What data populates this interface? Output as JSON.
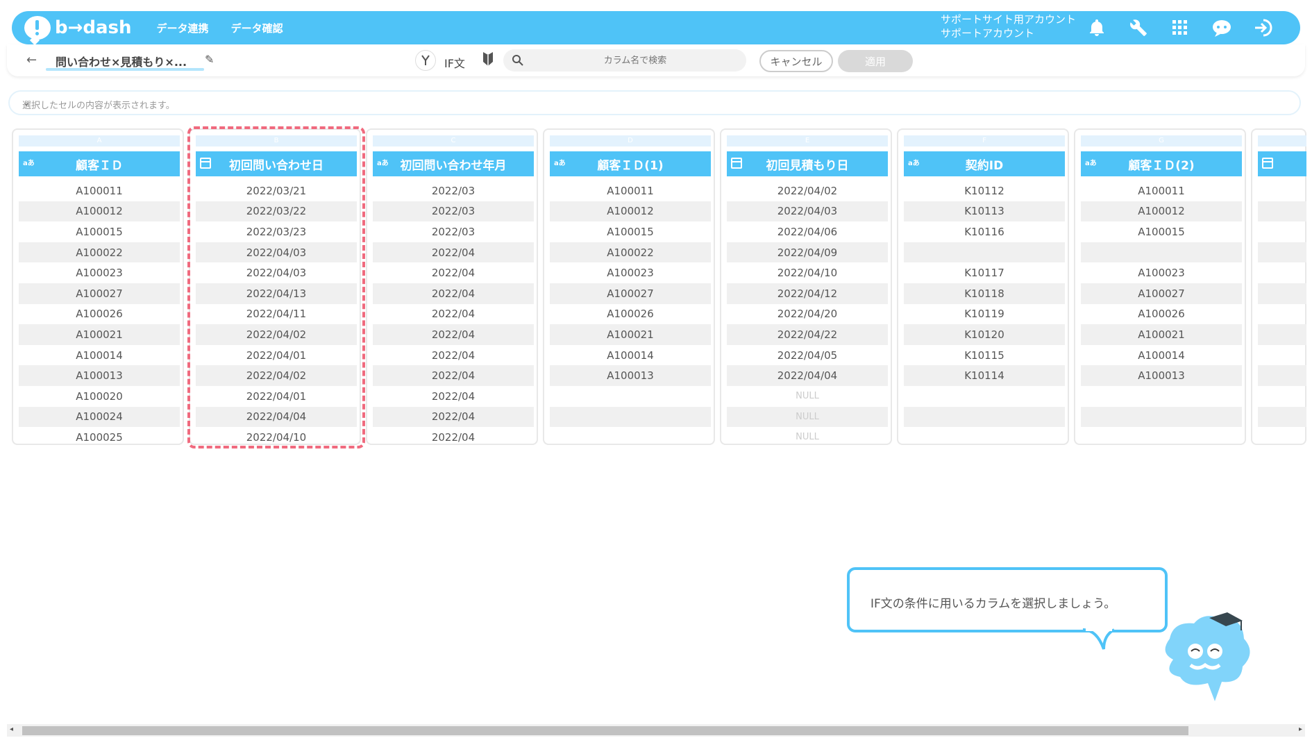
{
  "topbar": {
    "logo_text": "b→dash",
    "nav": [
      "データ連携",
      "データ確認"
    ],
    "account_line1": "サポートサイト用アカウント",
    "account_line2": "サポートアカウント",
    "icons": [
      "bell-icon",
      "wrench-icon",
      "grid-icon",
      "chat-icon",
      "logout-icon"
    ]
  },
  "toolbar": {
    "back": "←",
    "file_name": "問い合わせ×見積もり×...",
    "pencil": "✎",
    "if_label": "IF文",
    "search_placeholder": "カラム名で検索",
    "cancel_label": "キャンセル",
    "apply_label": "適用"
  },
  "cell_bar": {
    "placeholder": "選択したセルの内容が表示されます。",
    "chevron": "⌄"
  },
  "columns": [
    {
      "letter": "A",
      "type": "text",
      "type_label": "aあ",
      "title": "顧客ＩＤ",
      "values": [
        "A100011",
        "A100012",
        "A100015",
        "A100022",
        "A100023",
        "A100027",
        "A100026",
        "A100021",
        "A100014",
        "A100013",
        "A100020",
        "A100024",
        "A100025"
      ]
    },
    {
      "letter": "B",
      "type": "date",
      "title": "初回問い合わせ日",
      "values": [
        "2022/03/21",
        "2022/03/22",
        "2022/03/23",
        "2022/04/03",
        "2022/04/03",
        "2022/04/13",
        "2022/04/11",
        "2022/04/02",
        "2022/04/01",
        "2022/04/02",
        "2022/04/01",
        "2022/04/04",
        "2022/04/10"
      ]
    },
    {
      "letter": "C",
      "type": "text",
      "type_label": "aあ",
      "title": "初回問い合わせ年月",
      "values": [
        "2022/03",
        "2022/03",
        "2022/03",
        "2022/04",
        "2022/04",
        "2022/04",
        "2022/04",
        "2022/04",
        "2022/04",
        "2022/04",
        "2022/04",
        "2022/04",
        "2022/04"
      ]
    },
    {
      "letter": "D",
      "type": "text",
      "type_label": "aあ",
      "title": "顧客ＩＤ(1)",
      "values": [
        "A100011",
        "A100012",
        "A100015",
        "A100022",
        "A100023",
        "A100027",
        "A100026",
        "A100021",
        "A100014",
        "A100013",
        "",
        "",
        ""
      ]
    },
    {
      "letter": "E",
      "type": "date",
      "title": "初回見積もり日",
      "values": [
        "2022/04/02",
        "2022/04/03",
        "2022/04/06",
        "2022/04/09",
        "2022/04/10",
        "2022/04/12",
        "2022/04/20",
        "2022/04/22",
        "2022/04/05",
        "2022/04/04",
        "NULL",
        "NULL",
        "NULL"
      ]
    },
    {
      "letter": "F",
      "type": "text",
      "type_label": "aあ",
      "title": "契約ID",
      "values": [
        "K10112",
        "K10113",
        "K10116",
        "",
        "K10117",
        "K10118",
        "K10119",
        "K10120",
        "K10115",
        "K10114",
        "",
        "",
        ""
      ]
    },
    {
      "letter": "G",
      "type": "text",
      "type_label": "aあ",
      "title": "顧客ＩＤ(2)",
      "values": [
        "A100011",
        "A100012",
        "A100015",
        "",
        "A100023",
        "A100027",
        "A100026",
        "A100021",
        "A100014",
        "A100013",
        "",
        "",
        ""
      ]
    },
    {
      "letter": "",
      "type": "date",
      "title": "",
      "values": [
        "",
        "",
        "",
        "",
        "",
        "",
        "",
        "",
        "",
        "",
        "",
        "",
        ""
      ]
    }
  ],
  "tooltip": {
    "text": "IF文の条件に用いるカラムを選択しましょう。"
  },
  "scrollbar": {
    "left": "◂",
    "right": "▸"
  }
}
